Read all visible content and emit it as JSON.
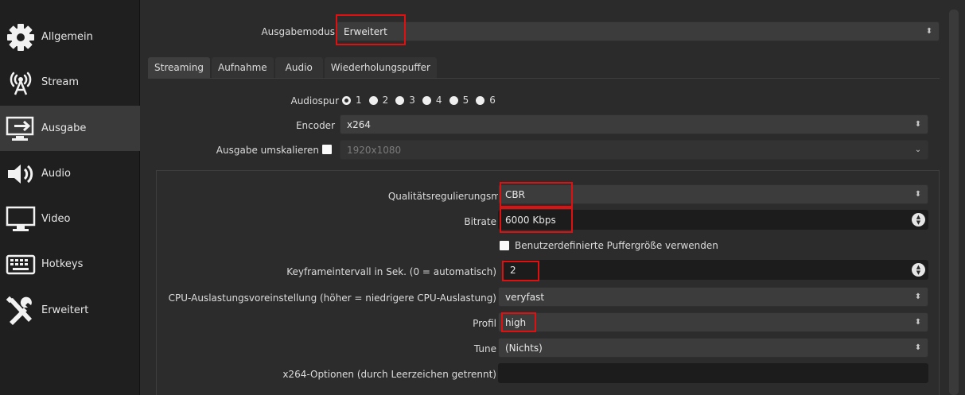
{
  "sidebar": {
    "items": [
      {
        "label": "Allgemein",
        "icon": "gear-icon"
      },
      {
        "label": "Stream",
        "icon": "broadcast-icon"
      },
      {
        "label": "Ausgabe",
        "icon": "output-icon",
        "active": true
      },
      {
        "label": "Audio",
        "icon": "speaker-icon"
      },
      {
        "label": "Video",
        "icon": "monitor-icon"
      },
      {
        "label": "Hotkeys",
        "icon": "keyboard-icon"
      },
      {
        "label": "Erweitert",
        "icon": "tools-icon"
      }
    ]
  },
  "output_mode": {
    "label": "Ausgabemodus",
    "value": "Erweitert"
  },
  "tabs": [
    {
      "label": "Streaming",
      "active": true
    },
    {
      "label": "Aufnahme"
    },
    {
      "label": "Audio"
    },
    {
      "label": "Wiederholungspuffer"
    }
  ],
  "audiospur": {
    "label": "Audiospur",
    "options": [
      "1",
      "2",
      "3",
      "4",
      "5",
      "6"
    ],
    "selected": "1"
  },
  "encoder": {
    "label": "Encoder",
    "value": "x264"
  },
  "rescale": {
    "label": "Ausgabe umskalieren",
    "value": "1920x1080"
  },
  "rate_control": {
    "label": "Qualitätsregulierungsmethode",
    "value": "CBR"
  },
  "bitrate": {
    "label": "Bitrate",
    "value": "6000 Kbps"
  },
  "custom_buffer": {
    "label": "Benutzerdefinierte Puffergröße verwenden"
  },
  "keyframe": {
    "label": "Keyframeintervall in Sek. (0 = automatisch)",
    "value": "2"
  },
  "cpu_preset": {
    "label": "CPU-Auslastungsvoreinstellung (höher = niedrigere CPU-Auslastung)",
    "value": "veryfast"
  },
  "profile": {
    "label": "Profil",
    "value": "high"
  },
  "tune": {
    "label": "Tune",
    "value": "(Nichts)"
  },
  "x264_options": {
    "label": "x264-Optionen (durch Leerzeichen getrennt)",
    "value": ""
  },
  "colors": {
    "highlight": "#e01010",
    "sidebar_active": "#3a3a3a",
    "background": "#2b2b2b"
  }
}
